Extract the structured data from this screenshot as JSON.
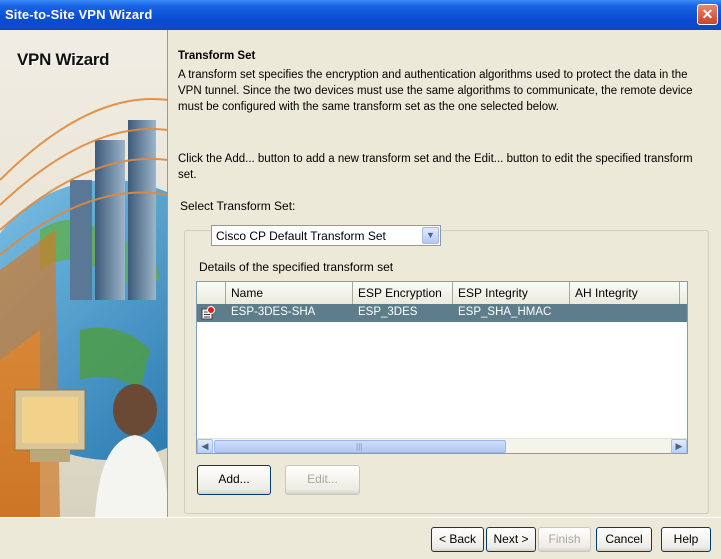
{
  "window": {
    "title": "Site-to-Site VPN Wizard",
    "close_glyph": "✕"
  },
  "sidebar": {
    "wizard_name": "VPN Wizard"
  },
  "section": {
    "title": "Transform Set",
    "description": "A transform set specifies the encryption and authentication algorithms used to protect the data in the VPN tunnel. Since the two devices must use the same algorithms to communicate, the remote device must be configured with the same transform set as the one selected below.",
    "instructions": "Click the Add... button to add a new transform set and the Edit... button to edit the specified transform set."
  },
  "select": {
    "label": "Select Transform Set:",
    "value": "Cisco CP Default Transform Set",
    "arrow_glyph": "▼"
  },
  "details": {
    "label": "Details of the specified transform set",
    "columns": [
      "Name",
      "ESP Encryption",
      "ESP Integrity",
      "AH Integrity"
    ],
    "rows": [
      {
        "icon": "transform-set-icon",
        "name": "ESP-3DES-SHA",
        "esp_encryption": "ESP_3DES",
        "esp_integrity": "ESP_SHA_HMAC",
        "ah_integrity": ""
      }
    ],
    "scroll_left_glyph": "◀",
    "scroll_right_glyph": "▶",
    "thumb_grip": "|||"
  },
  "actions": {
    "add": "Add...",
    "edit": "Edit..."
  },
  "footer": {
    "back": "< Back",
    "next": "Next >",
    "finish": "Finish",
    "cancel": "Cancel",
    "help": "Help"
  },
  "colors": {
    "title_bar": "#0a4ed6",
    "selected_row": "#5d7d8a",
    "dialog_bg": "#ece9d8"
  }
}
